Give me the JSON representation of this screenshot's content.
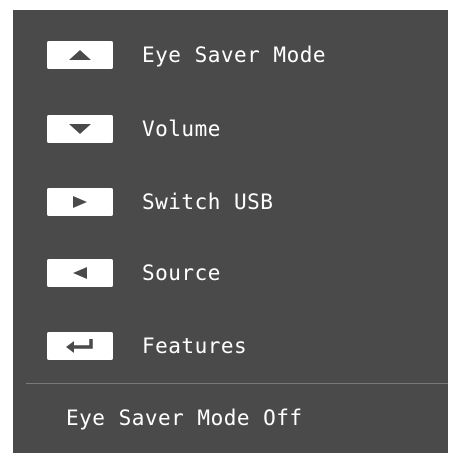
{
  "osd_menu": {
    "items": [
      {
        "icon": "triangle-up-icon",
        "label": "Eye Saver Mode"
      },
      {
        "icon": "triangle-down-icon",
        "label": "Volume"
      },
      {
        "icon": "triangle-right-icon",
        "label": "Switch USB"
      },
      {
        "icon": "triangle-left-icon",
        "label": "Source"
      },
      {
        "icon": "return-arrow-icon",
        "label": "Features"
      }
    ],
    "status": "Eye Saver Mode Off"
  },
  "colors": {
    "panel_background": "#4a4a4a",
    "text": "#ffffff",
    "key_background": "#ffffff",
    "key_icon": "#4a4a4a",
    "divider": "#7a7a7a"
  }
}
